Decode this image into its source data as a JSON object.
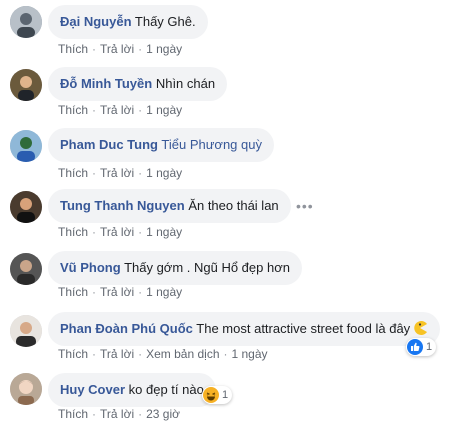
{
  "comments": [
    {
      "author": "Đại Nguyễn",
      "text": "Thấy Ghê.",
      "actions": {
        "like": "Thích",
        "reply": "Trả lời",
        "time": "1 ngày"
      }
    },
    {
      "author": "Đỗ Minh Tuyền",
      "text": "Nhìn chán",
      "actions": {
        "like": "Thích",
        "reply": "Trả lời",
        "time": "1 ngày"
      }
    },
    {
      "author": "Pham Duc Tung",
      "text": "Phương quỳ",
      "mention": "Tiểu",
      "actions": {
        "like": "Thích",
        "reply": "Trả lời",
        "time": "1 ngày"
      }
    },
    {
      "author": "Tung Thanh Nguyen",
      "text": "Ăn theo thái lan",
      "actions": {
        "like": "Thích",
        "reply": "Trả lời",
        "time": "1 ngày"
      }
    },
    {
      "author": "Vũ Phong",
      "text": "Thấy gớm . Ngũ Hổ đẹp hơn",
      "actions": {
        "like": "Thích",
        "reply": "Trả lời",
        "time": "1 ngày"
      }
    },
    {
      "author": "Phan Đoàn Phú Quốc",
      "text": "The most attractive street food là đây",
      "emoji": "pacman-icon",
      "actions": {
        "like": "Thích",
        "reply": "Trả lời",
        "translate": "Xem bản dịch",
        "time": "1 ngày"
      },
      "reaction": {
        "type": "like-icon",
        "count": "1"
      }
    },
    {
      "author": "Huy Cover",
      "text": "ko đẹp tí nào",
      "actions": {
        "like": "Thích",
        "reply": "Trả lời",
        "time": "23 giờ"
      },
      "reaction": {
        "type": "haha-icon",
        "count": "1"
      }
    }
  ],
  "colors": {
    "author": "#385898",
    "bubble": "#f2f3f5",
    "meta": "#616770",
    "like_blue": "#1877f2",
    "haha_yellow": "#f7b125"
  },
  "more_icon": "more-options-icon"
}
